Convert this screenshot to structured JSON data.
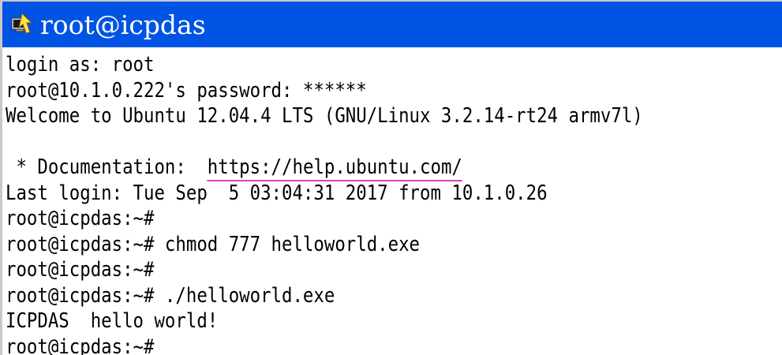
{
  "window": {
    "title": "root@icpdas",
    "title_icon": "putty-terminal-icon"
  },
  "terminal": {
    "lines": [
      "login as: root",
      "root@10.1.0.222's password: ******",
      "Welcome to Ubuntu 12.04.4 LTS (GNU/Linux 3.2.14-rt24 armv7l)",
      "",
      " * Documentation:  ",
      "Last login: Tue Sep  5 03:04:31 2017 from 10.1.0.26",
      "root@icpdas:~#",
      "root@icpdas:~# chmod 777 helloworld.exe",
      "root@icpdas:~#",
      "root@icpdas:~# ./helloworld.exe",
      "ICPDAS  hello world!",
      "root@icpdas:~#"
    ],
    "documentation_url": "https://help.ubuntu.com/"
  },
  "colors": {
    "titlebar": "#0054e3",
    "title_text": "#ffffff",
    "terminal_bg": "#ffffff",
    "terminal_fg": "#000000",
    "link_underline": "#e040c0"
  }
}
